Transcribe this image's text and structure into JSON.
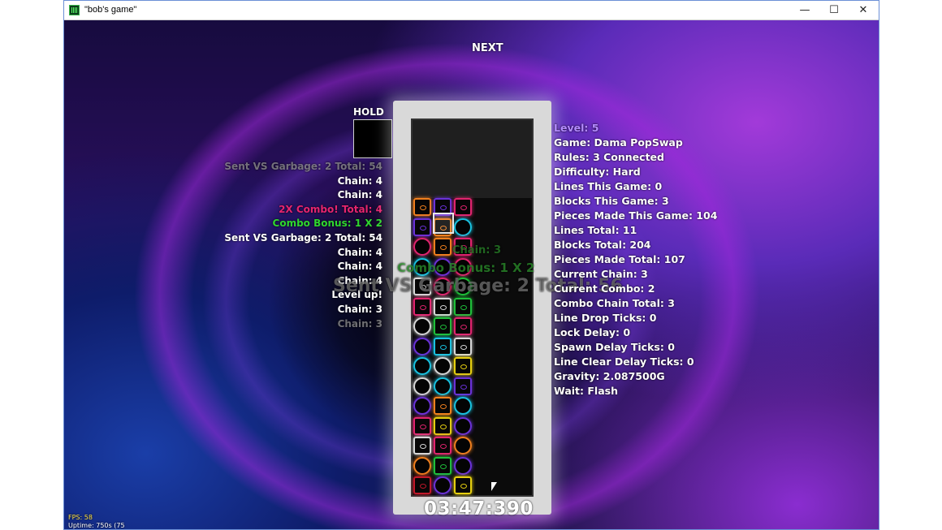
{
  "window": {
    "title": "\"bob's game\"",
    "minimize": "—",
    "maximize": "☐",
    "close": "✕"
  },
  "game": {
    "next_label": "NEXT",
    "hold_label": "HOLD",
    "timer": "03:47:390",
    "fps": "FPS: 58",
    "uptime": "Uptime: 750s (75"
  },
  "log": [
    {
      "text": "Sent VS Garbage: 2 Total: 54",
      "style": "dim"
    },
    {
      "text": "Chain: 4",
      "style": "white"
    },
    {
      "text": "Chain: 4",
      "style": "white"
    },
    {
      "text": "2X Combo! Total: 4",
      "style": "magenta"
    },
    {
      "text": "Combo Bonus: 1 X 2",
      "style": "green"
    },
    {
      "text": "Sent VS Garbage: 2 Total: 54",
      "style": "white"
    },
    {
      "text": "Chain: 4",
      "style": "white"
    },
    {
      "text": "Chain: 4",
      "style": "white"
    },
    {
      "text": "Chain: 4",
      "style": "white"
    },
    {
      "text": "Level up!",
      "style": "white"
    },
    {
      "text": "Chain: 3",
      "style": "white"
    },
    {
      "text": "Chain: 3",
      "style": "dim"
    }
  ],
  "overlays": {
    "big_ghost": "Sent VS Garbage: 2 Total: 56",
    "ghost_combo": "Combo Bonus: 1 X 2",
    "ghost_chain": "Chain: 3"
  },
  "stats": [
    {
      "text": "Level: 5",
      "style": "level"
    },
    {
      "text": "Game: Dama PopSwap"
    },
    {
      "text": "Rules: 3 Connected"
    },
    {
      "text": "Difficulty: Hard"
    },
    {
      "text": "Lines This Game: 0"
    },
    {
      "text": "Blocks This Game: 3"
    },
    {
      "text": "Pieces Made This Game: 104"
    },
    {
      "text": "Lines Total: 11"
    },
    {
      "text": "Blocks Total: 204"
    },
    {
      "text": "Pieces Made Total: 107"
    },
    {
      "text": "Current Chain: 3"
    },
    {
      "text": "Current Combo: 2"
    },
    {
      "text": "Combo Chain Total: 3"
    },
    {
      "text": "Line Drop Ticks: 0"
    },
    {
      "text": "Lock Delay: 0"
    },
    {
      "text": "Spawn Delay Ticks: 0"
    },
    {
      "text": "Line Clear Delay Ticks: 0"
    },
    {
      "text": "Gravity: 2.087500G"
    },
    {
      "text": "Wait: Flash"
    }
  ],
  "palette": {
    "O": "#f07f1e",
    "P": "#6a32d8",
    "M": "#e0246e",
    "Y": "#e6cf10",
    "C": "#19c2e0",
    "G": "#1fbf3a",
    "W": "#d8d8d8",
    "R": "#c0182a"
  },
  "board": [
    "........",
    "........",
    "........",
    "........",
    "Os.P..Ms",
    "Ps.Os.Cr",
    "Mr.Os.My",
    "Cr.Pr.Mr",
    "Ws.Mr.Gr",
    "Ms.Ws.Gs",
    "Wr.Gs.Ms",
    "Pr.Cs.Ws",
    "Cr.Wr.Ys",
    "Wr.Cr.Ps",
    "Pr.Os.Cr",
    "Ms.Ys.Pr",
    "Ws.Ms.Or",
    "Or.Gs.Pr",
    "Rs.Pr.Ys"
  ]
}
